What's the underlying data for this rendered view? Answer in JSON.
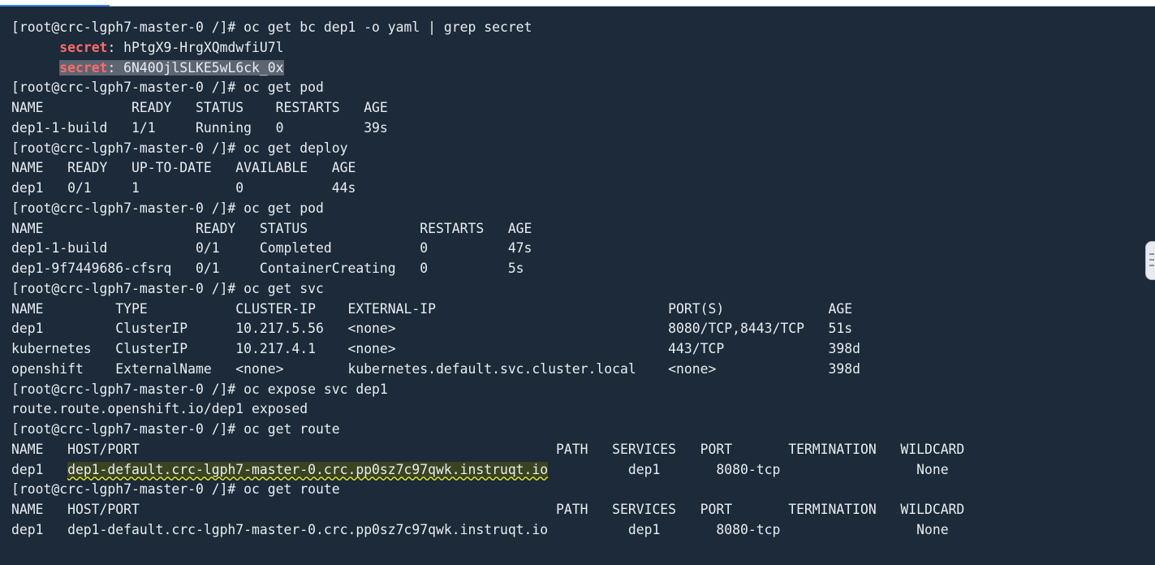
{
  "terminal": {
    "lines": [
      {
        "segments": [
          {
            "text": "[root@crc-lgph7-master-0 /]# oc get bc dep1 -o yaml | grep secret"
          }
        ]
      },
      {
        "segments": [
          {
            "text": "      "
          },
          {
            "text": "secret",
            "style": "key"
          },
          {
            "text": ": hPtgX9-HrgXQmdwfiU7l"
          }
        ]
      },
      {
        "segments": [
          {
            "text": "      "
          },
          {
            "text": "secret",
            "style": "key sel"
          },
          {
            "text": ": 6N40OjlSLKE5wL6ck_0x",
            "style": "sel"
          }
        ]
      },
      {
        "segments": [
          {
            "text": "[root@crc-lgph7-master-0 /]# oc get pod"
          }
        ]
      },
      {
        "segments": [
          {
            "text": "NAME           READY   STATUS    RESTARTS   AGE"
          }
        ]
      },
      {
        "segments": [
          {
            "text": "dep1-1-build   1/1     Running   0          39s"
          }
        ]
      },
      {
        "segments": [
          {
            "text": "[root@crc-lgph7-master-0 /]# oc get deploy"
          }
        ]
      },
      {
        "segments": [
          {
            "text": "NAME   READY   UP-TO-DATE   AVAILABLE   AGE"
          }
        ]
      },
      {
        "segments": [
          {
            "text": "dep1   0/1     1            0           44s"
          }
        ]
      },
      {
        "segments": [
          {
            "text": "[root@crc-lgph7-master-0 /]# oc get pod"
          }
        ]
      },
      {
        "segments": [
          {
            "text": "NAME                   READY   STATUS              RESTARTS   AGE"
          }
        ]
      },
      {
        "segments": [
          {
            "text": "dep1-1-build           0/1     Completed           0          47s"
          }
        ]
      },
      {
        "segments": [
          {
            "text": "dep1-9f7449686-cfsrq   0/1     ContainerCreating   0          5s"
          }
        ]
      },
      {
        "segments": [
          {
            "text": "[root@crc-lgph7-master-0 /]# oc get svc"
          }
        ]
      },
      {
        "segments": [
          {
            "text": "NAME         TYPE           CLUSTER-IP    EXTERNAL-IP                             PORT(S)             AGE"
          }
        ]
      },
      {
        "segments": [
          {
            "text": "dep1         ClusterIP      10.217.5.56   <none>                                  8080/TCP,8443/TCP   51s"
          }
        ]
      },
      {
        "segments": [
          {
            "text": "kubernetes   ClusterIP      10.217.4.1    <none>                                  443/TCP             398d"
          }
        ]
      },
      {
        "segments": [
          {
            "text": "openshift    ExternalName   <none>        kubernetes.default.svc.cluster.local    <none>              398d"
          }
        ]
      },
      {
        "segments": [
          {
            "text": "[root@crc-lgph7-master-0 /]# oc expose svc dep1"
          }
        ]
      },
      {
        "segments": [
          {
            "text": "route.route.openshift.io/dep1 exposed"
          }
        ]
      },
      {
        "segments": [
          {
            "text": "[root@crc-lgph7-master-0 /]# oc get route"
          }
        ]
      },
      {
        "segments": [
          {
            "text": "NAME   HOST/PORT                                                    PATH   SERVICES   PORT       TERMINATION   WILDCARD"
          }
        ]
      },
      {
        "segments": [
          {
            "text": "dep1   "
          },
          {
            "text": "dep1-default.crc-lgph7-master-0.crc.pp0sz7c97qwk.instruqt.io",
            "style": "hl"
          },
          {
            "text": "          dep1       8080-tcp                 None"
          }
        ]
      },
      {
        "segments": [
          {
            "text": "[root@crc-lgph7-master-0 /]# oc get route"
          }
        ]
      },
      {
        "segments": [
          {
            "text": "NAME   HOST/PORT                                                    PATH   SERVICES   PORT       TERMINATION   WILDCARD"
          }
        ]
      },
      {
        "segments": [
          {
            "text": "dep1   dep1-default.crc-lgph7-master-0.crc.pp0sz7c97qwk.instruqt.io          dep1       8080-tcp                 None"
          }
        ]
      }
    ]
  },
  "colors": {
    "background": "#1c2a39",
    "text": "#e8edf2",
    "secret_keyword": "#ff6b6b",
    "selection": "#5c6571",
    "highlight_underline": "#d7e021"
  },
  "icons": {
    "scroll_handle": "grip-handle-icon"
  }
}
